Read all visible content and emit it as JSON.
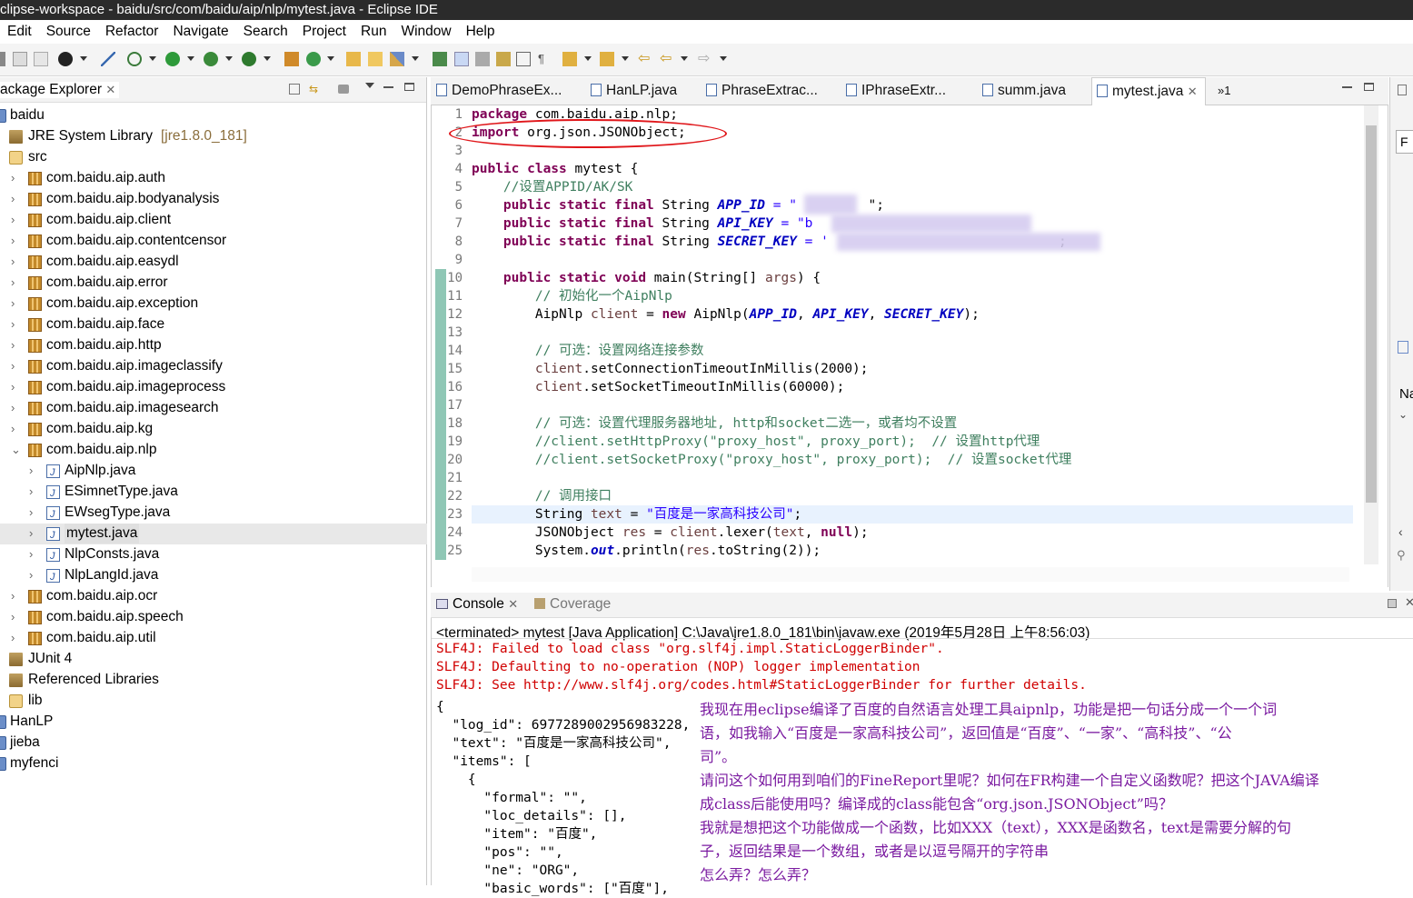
{
  "window": {
    "title": "clipse-workspace - baidu/src/com/baidu/aip/nlp/mytest.java - Eclipse IDE"
  },
  "menu": [
    "Edit",
    "Source",
    "Refactor",
    "Navigate",
    "Search",
    "Project",
    "Run",
    "Window",
    "Help"
  ],
  "package_explorer": {
    "title": "ackage Explorer",
    "tree": [
      {
        "label": "baidu",
        "extra": "",
        "icon": "project-icon",
        "expander": ""
      },
      {
        "label": "JRE System Library",
        "extra": "[jre1.8.0_181]",
        "icon": "library-icon",
        "expander": ""
      },
      {
        "label": "src",
        "extra": "",
        "icon": "source-folder-icon",
        "expander": ""
      },
      {
        "label": "com.baidu.aip.auth",
        "extra": "",
        "icon": "package-icon",
        "expander": ">"
      },
      {
        "label": "com.baidu.aip.bodyanalysis",
        "extra": "",
        "icon": "package-icon",
        "expander": ">"
      },
      {
        "label": "com.baidu.aip.client",
        "extra": "",
        "icon": "package-icon",
        "expander": ">"
      },
      {
        "label": "com.baidu.aip.contentcensor",
        "extra": "",
        "icon": "package-icon",
        "expander": ">"
      },
      {
        "label": "com.baidu.aip.easydl",
        "extra": "",
        "icon": "package-icon",
        "expander": ">"
      },
      {
        "label": "com.baidu.aip.error",
        "extra": "",
        "icon": "package-icon",
        "expander": ">"
      },
      {
        "label": "com.baidu.aip.exception",
        "extra": "",
        "icon": "package-icon",
        "expander": ">"
      },
      {
        "label": "com.baidu.aip.face",
        "extra": "",
        "icon": "package-icon",
        "expander": ">"
      },
      {
        "label": "com.baidu.aip.http",
        "extra": "",
        "icon": "package-icon",
        "expander": ">"
      },
      {
        "label": "com.baidu.aip.imageclassify",
        "extra": "",
        "icon": "package-icon",
        "expander": ">"
      },
      {
        "label": "com.baidu.aip.imageprocess",
        "extra": "",
        "icon": "package-icon",
        "expander": ">"
      },
      {
        "label": "com.baidu.aip.imagesearch",
        "extra": "",
        "icon": "package-icon",
        "expander": ">"
      },
      {
        "label": "com.baidu.aip.kg",
        "extra": "",
        "icon": "package-icon",
        "expander": ">"
      },
      {
        "label": "com.baidu.aip.nlp",
        "extra": "",
        "icon": "package-icon",
        "expander": "v"
      },
      {
        "label": "AipNlp.java",
        "extra": "",
        "icon": "java-file-icon",
        "expander": ">"
      },
      {
        "label": "ESimnetType.java",
        "extra": "",
        "icon": "java-file-icon",
        "expander": ">"
      },
      {
        "label": "EWsegType.java",
        "extra": "",
        "icon": "java-file-icon",
        "expander": ">"
      },
      {
        "label": "mytest.java",
        "extra": "",
        "icon": "java-file-icon",
        "expander": ">"
      },
      {
        "label": "NlpConsts.java",
        "extra": "",
        "icon": "java-file-icon",
        "expander": ">"
      },
      {
        "label": "NlpLangId.java",
        "extra": "",
        "icon": "java-file-icon",
        "expander": ">"
      },
      {
        "label": "com.baidu.aip.ocr",
        "extra": "",
        "icon": "package-icon",
        "expander": ">"
      },
      {
        "label": "com.baidu.aip.speech",
        "extra": "",
        "icon": "package-icon",
        "expander": ">"
      },
      {
        "label": "com.baidu.aip.util",
        "extra": "",
        "icon": "package-icon",
        "expander": ">"
      },
      {
        "label": "JUnit 4",
        "extra": "",
        "icon": "library-icon",
        "expander": ""
      },
      {
        "label": "Referenced Libraries",
        "extra": "",
        "icon": "library-icon",
        "expander": ""
      },
      {
        "label": "lib",
        "extra": "",
        "icon": "folder-icon",
        "expander": ""
      },
      {
        "label": "HanLP",
        "extra": "",
        "icon": "project-icon",
        "expander": ""
      },
      {
        "label": "jieba",
        "extra": "",
        "icon": "project-icon",
        "expander": ""
      },
      {
        "label": "myfenci",
        "extra": "",
        "icon": "project-icon",
        "expander": ""
      }
    ]
  },
  "editor": {
    "tabs": [
      "DemoPhraseEx...",
      "HanLP.java",
      "PhraseExtrac...",
      "IPhraseExtr...",
      "summ.java",
      "mytest.java"
    ],
    "overflow_count": "»1",
    "line_numbers": [
      "1",
      "2",
      "3",
      "4",
      "5",
      "6",
      "7",
      "8",
      "9",
      "10",
      "11",
      "12",
      "13",
      "14",
      "15",
      "16",
      "17",
      "18",
      "19",
      "20",
      "21",
      "22",
      "23",
      "24",
      "25"
    ],
    "code": {
      "l1": "package com.baidu.aip.nlp;",
      "l2": "import org.json.JSONObject;",
      "l4a": "public class",
      "l4b": " mytest {",
      "l5": "    //设置APPID/AK/SK",
      "kw_psf": "public static final",
      "string_t": " String ",
      "app_id": "APP_ID",
      "api_key": "API_KEY",
      "secret_key": "SECRET_KEY",
      "eq_q": " = \"",
      "l6_tail": "\";",
      "l7_head": " = \"b",
      "l8_head": " = '",
      "l8_tail": ";",
      "l10a": "public static void",
      "l10b": " main(String[] ",
      "l10c": "args",
      "l10d": ") {",
      "l11": "        // 初始化一个AipNlp",
      "l12a": "        AipNlp ",
      "l12b": "client",
      "l12c": " = ",
      "l12d": "new",
      "l12e": " AipNlp(",
      "l12f": ", ",
      "l12g": ");",
      "l14": "        // 可选：设置网络连接参数",
      "l15a": "        ",
      "l15b": ".setConnectionTimeoutInMillis(2000);",
      "l16b": ".setSocketTimeoutInMillis(60000);",
      "l18": "        // 可选：设置代理服务器地址, http和socket二选一，或者均不设置",
      "l19": "        //client.setHttpProxy(\"proxy_host\", proxy_port);  // 设置http代理",
      "l20": "        //client.setSocketProxy(\"proxy_host\", proxy_port);  // 设置socket代理",
      "l22": "        // 调用接口",
      "l23a": "        String ",
      "l23b": "text",
      "l23c": " = ",
      "l23d": "\"百度是一家高科技公司\"",
      "l23e": ";",
      "l24a": "        JSONObject ",
      "l24b": "res",
      "l24c": " = ",
      "l24d": ".lexer(",
      "l24e": ", ",
      "l24f": "null",
      "l24g": ");",
      "l25a": "        System.",
      "l25b": "out",
      "l25c": ".println(",
      "l25d": ".toString(2));"
    }
  },
  "console": {
    "tabs": [
      "Console",
      "Coverage"
    ],
    "terminated": "<terminated> mytest [Java Application] C:\\Java\\jre1.8.0_181\\bin\\javaw.exe (2019年5月28日 上午8:56:03)",
    "errors": [
      "SLF4J: Failed to load class \"org.slf4j.impl.StaticLoggerBinder\".",
      "SLF4J: Defaulting to no-operation (NOP) logger implementation",
      "SLF4J: See http://www.slf4j.org/codes.html#StaticLoggerBinder for further details."
    ],
    "output": [
      "{",
      "  \"log_id\": 6977289002956983228,",
      "  \"text\": \"百度是一家高科技公司\",",
      "  \"items\": [",
      "    {",
      "      \"formal\": \"\",",
      "      \"loc_details\": [],",
      "      \"item\": \"百度\",",
      "      \"pos\": \"\",",
      "      \"ne\": \"ORG\",",
      "      \"basic_words\": [\"百度\"],"
    ],
    "note": [
      "我现在用eclipse编译了百度的自然语言处理工具aipnlp，功能是把一句话分成一个一个词",
      "语，如我输入“百度是一家高科技公司”，返回值是“百度”、“一家”、“高科技”、“公",
      "司”。",
      "请问这个如何用到咱们的FineReport里呢？如何在FR构建一个自定义函数呢？把这个JAVA编译",
      "成class后能使用吗？编译成的class能包含“org.json.JSONObject”吗？",
      "我就是想把这个功能做成一个函数，比如XXX（text），XXX是函数名，text是需要分解的句",
      "子，返回结果是一个数组，或者是以逗号隔开的字符串",
      "怎么弄？怎么弄？"
    ]
  },
  "right_strip": {
    "field_letter": "F",
    "na_label": "Na"
  }
}
